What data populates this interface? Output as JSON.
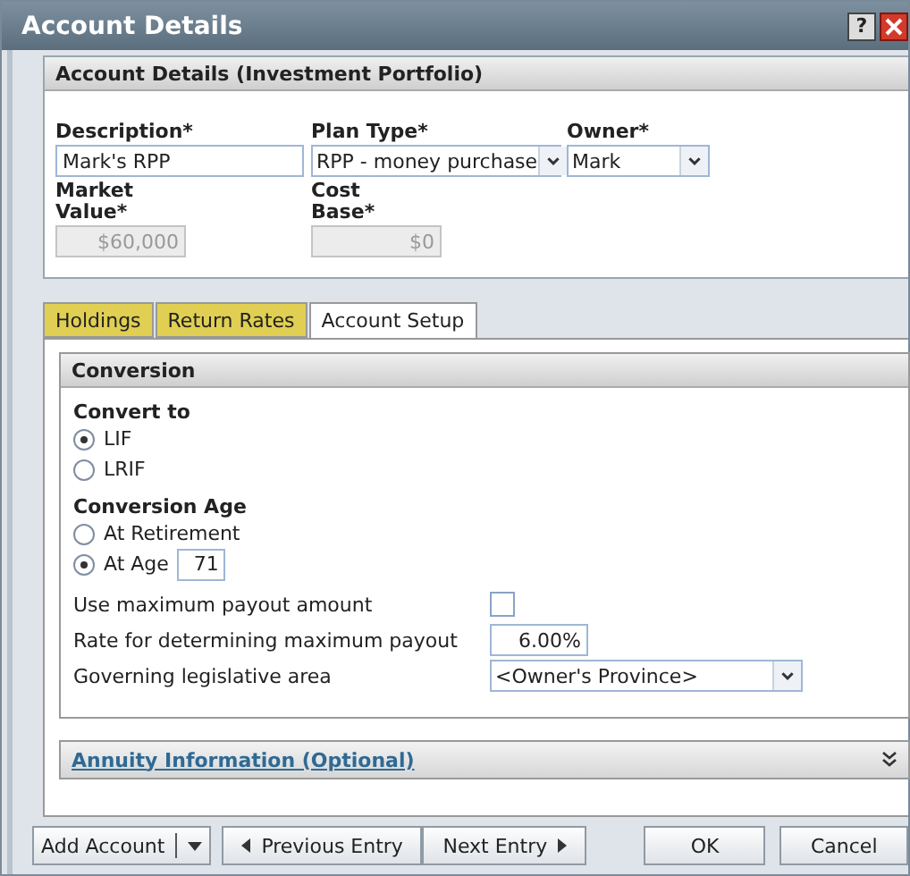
{
  "window": {
    "title": "Account Details",
    "help": "?"
  },
  "section": {
    "title": "Account Details (Investment Portfolio)",
    "fields": [
      {
        "label": "Description*",
        "kind": "text",
        "value": "Mark's RPP",
        "disabled": false
      },
      {
        "label": "Plan Type*",
        "kind": "select",
        "value": "RPP - money purchase"
      },
      {
        "label": "Owner*",
        "kind": "select",
        "value": "Mark"
      },
      {
        "label": "Market Value*",
        "kind": "text",
        "value": "$60,000",
        "disabled": true
      },
      {
        "label": "Cost Base*",
        "kind": "text",
        "value": "$0",
        "disabled": true
      }
    ]
  },
  "tabs": [
    {
      "label": "Holdings",
      "selected": false
    },
    {
      "label": "Return Rates",
      "selected": false
    },
    {
      "label": "Account Setup",
      "selected": true
    }
  ],
  "conversion": {
    "title": "Conversion",
    "convert_to": {
      "label": "Convert to",
      "options": [
        {
          "label": "LIF",
          "selected": true
        },
        {
          "label": "LRIF",
          "selected": false
        }
      ]
    },
    "conversion_age": {
      "label": "Conversion Age",
      "options": [
        {
          "label": "At Retirement",
          "selected": false
        },
        {
          "label": "At Age",
          "selected": true,
          "value": "71"
        }
      ]
    },
    "settings": [
      {
        "label": "Use maximum payout amount",
        "kind": "checkbox",
        "checked": false
      },
      {
        "label": "Rate for determining maximum payout",
        "kind": "text",
        "value": "6.00%"
      },
      {
        "label": "Governing legislative area",
        "kind": "select",
        "value": "<Owner's Province>"
      }
    ]
  },
  "annuity": {
    "title": "Annuity Information (Optional)",
    "expanded": false
  },
  "buttons": [
    {
      "label": "Add Account",
      "kind": "split"
    },
    {
      "label": "Previous Entry",
      "kind": "prev"
    },
    {
      "label": "Next Entry",
      "kind": "next"
    },
    {
      "label": "OK",
      "kind": "plain"
    },
    {
      "label": "Cancel",
      "kind": "plain"
    }
  ]
}
